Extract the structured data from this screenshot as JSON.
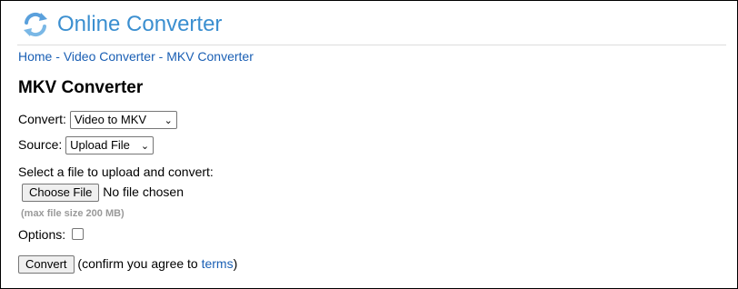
{
  "brand": {
    "name": "Online Converter",
    "logo_icon": "refresh-arrows-icon",
    "color": "#3b8fd0"
  },
  "breadcrumb": {
    "items": [
      "Home",
      "Video Converter",
      "MKV Converter"
    ],
    "separator": "-"
  },
  "page_title": "MKV Converter",
  "convert": {
    "label": "Convert:",
    "selected": "Video to MKV"
  },
  "source": {
    "label": "Source:",
    "selected": "Upload File"
  },
  "upload": {
    "prompt": "Select a file to upload and convert:",
    "choose_button": "Choose File",
    "status": "No file chosen",
    "note": "(max file size 200 MB)"
  },
  "options": {
    "label": "Options:",
    "checked": false
  },
  "submit": {
    "button": "Convert",
    "confirm_prefix": "(confirm you agree to ",
    "terms_link": "terms",
    "confirm_suffix": ")"
  },
  "colors": {
    "link": "#1a5fb4",
    "muted": "#9a9a9a"
  }
}
